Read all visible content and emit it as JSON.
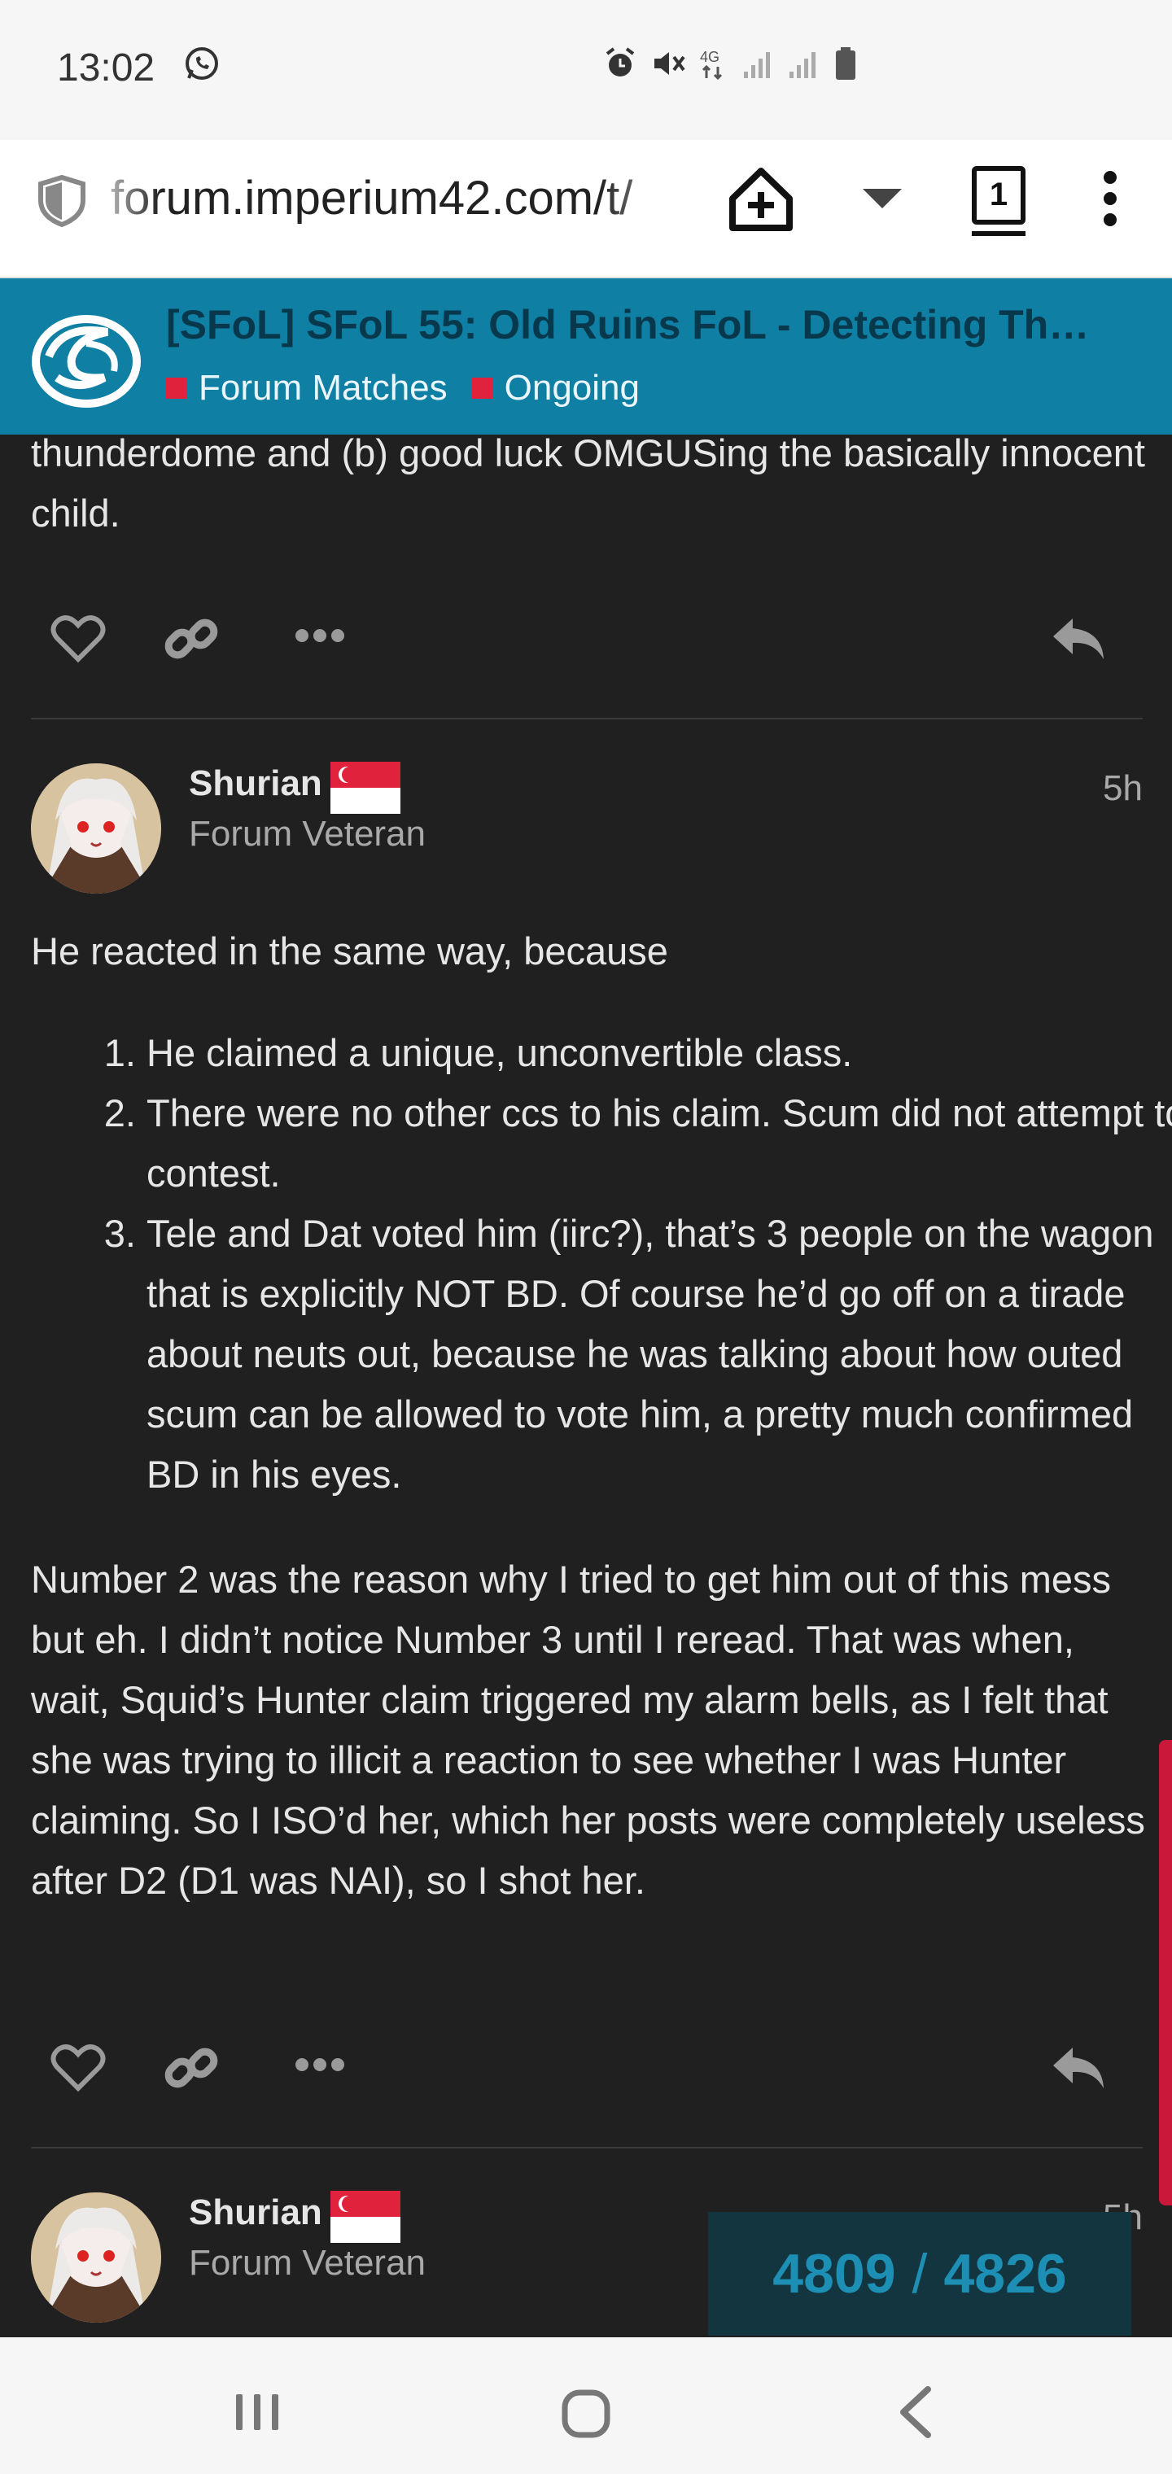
{
  "status_bar": {
    "time": "13:02",
    "icons": [
      "whatsapp-icon",
      "alarm-icon",
      "mute-icon",
      "4g-icon",
      "signal-icon",
      "signal-icon",
      "battery-icon"
    ],
    "network": "4G"
  },
  "browser": {
    "url": "forum.imperium42.com/t/",
    "tab_count": "1"
  },
  "topic": {
    "title": "[SFoL] SFoL 55: Old Ruins FoL - Detecting The…",
    "categories": [
      "Forum Matches",
      "Ongoing"
    ],
    "category_color": "#e0223c",
    "header_color": "#0f7fa4"
  },
  "posts": [
    {
      "fragment": "thunderdome and (b) good luck OMGUSing the basically innocent child."
    },
    {
      "username": "Shurian",
      "user_title": "Forum Veteran",
      "time": "5h",
      "intro": "He reacted in the same way, because",
      "list": [
        "He claimed a unique, unconvertible class.",
        "There were no other ccs to his claim. Scum did not attempt to contest.",
        "Tele and Dat voted him (iirc?), that’s 3 people on the wagon that is explicitly NOT BD. Of course he’d go off on a tirade about neuts out, because he was talking about how outed scum can be allowed to vote him, a pretty much confirmed BD in his eyes."
      ],
      "body": "Number 2 was the reason why I tried to get him out of this mess but eh. I didn’t notice Number 3 until I reread. That was when, wait, Squid’s Hunter claim triggered my alarm bells, as I felt that she was trying to illicit a reaction to see whether I was Hunter claiming. So I ISO’d her, which her posts were completely useless after D2 (D1 was NAI), so I shot her."
    },
    {
      "username": "Shurian",
      "user_title": "Forum Veteran",
      "time": "5h"
    }
  ],
  "progress": {
    "current": "4809",
    "separator": "/",
    "total": "4826"
  }
}
